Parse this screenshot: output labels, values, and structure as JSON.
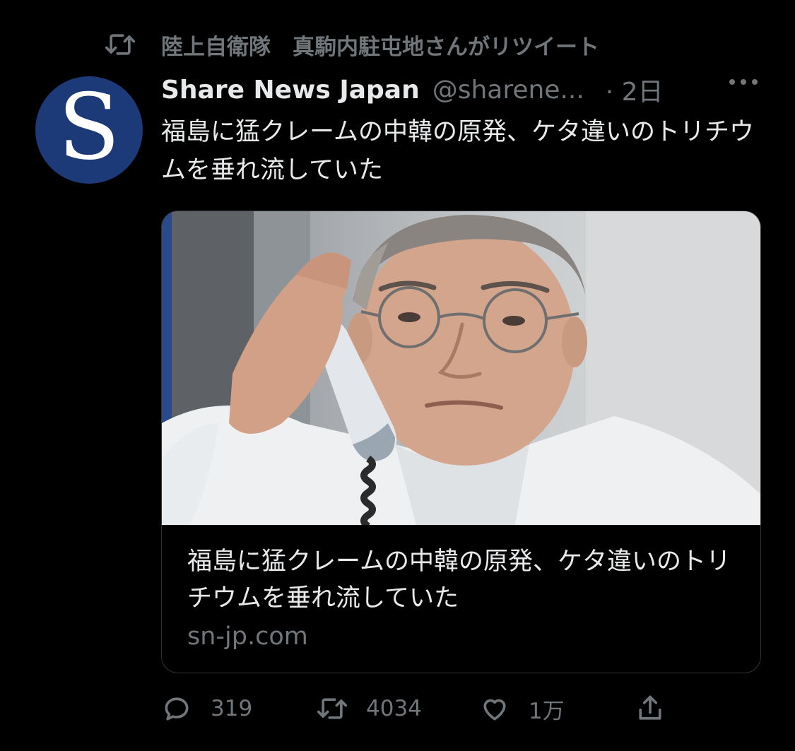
{
  "retweet": {
    "icon": "retweet-icon",
    "text": "陸上自衛隊　真駒内駐屯地さんがリツイート"
  },
  "tweet": {
    "avatar_letter": "S",
    "display_name": "Share News Japan",
    "handle": "@sharene...",
    "time": "· 2日",
    "text": "福島に猛クレームの中韓の原発、ケタ違いのトリチウムを垂れ流していた"
  },
  "card": {
    "title": "福島に猛クレームの中韓の原発、ケタ違いのトリチウムを垂れ流していた",
    "domain": "sn-jp.com"
  },
  "actions": {
    "reply_count": "319",
    "retweet_count": "4034",
    "like_count": "1万"
  },
  "colors": {
    "background": "#000000",
    "text_primary": "#e7e9ea",
    "text_secondary": "#71767b",
    "avatar_bg": "#1d3a78"
  }
}
